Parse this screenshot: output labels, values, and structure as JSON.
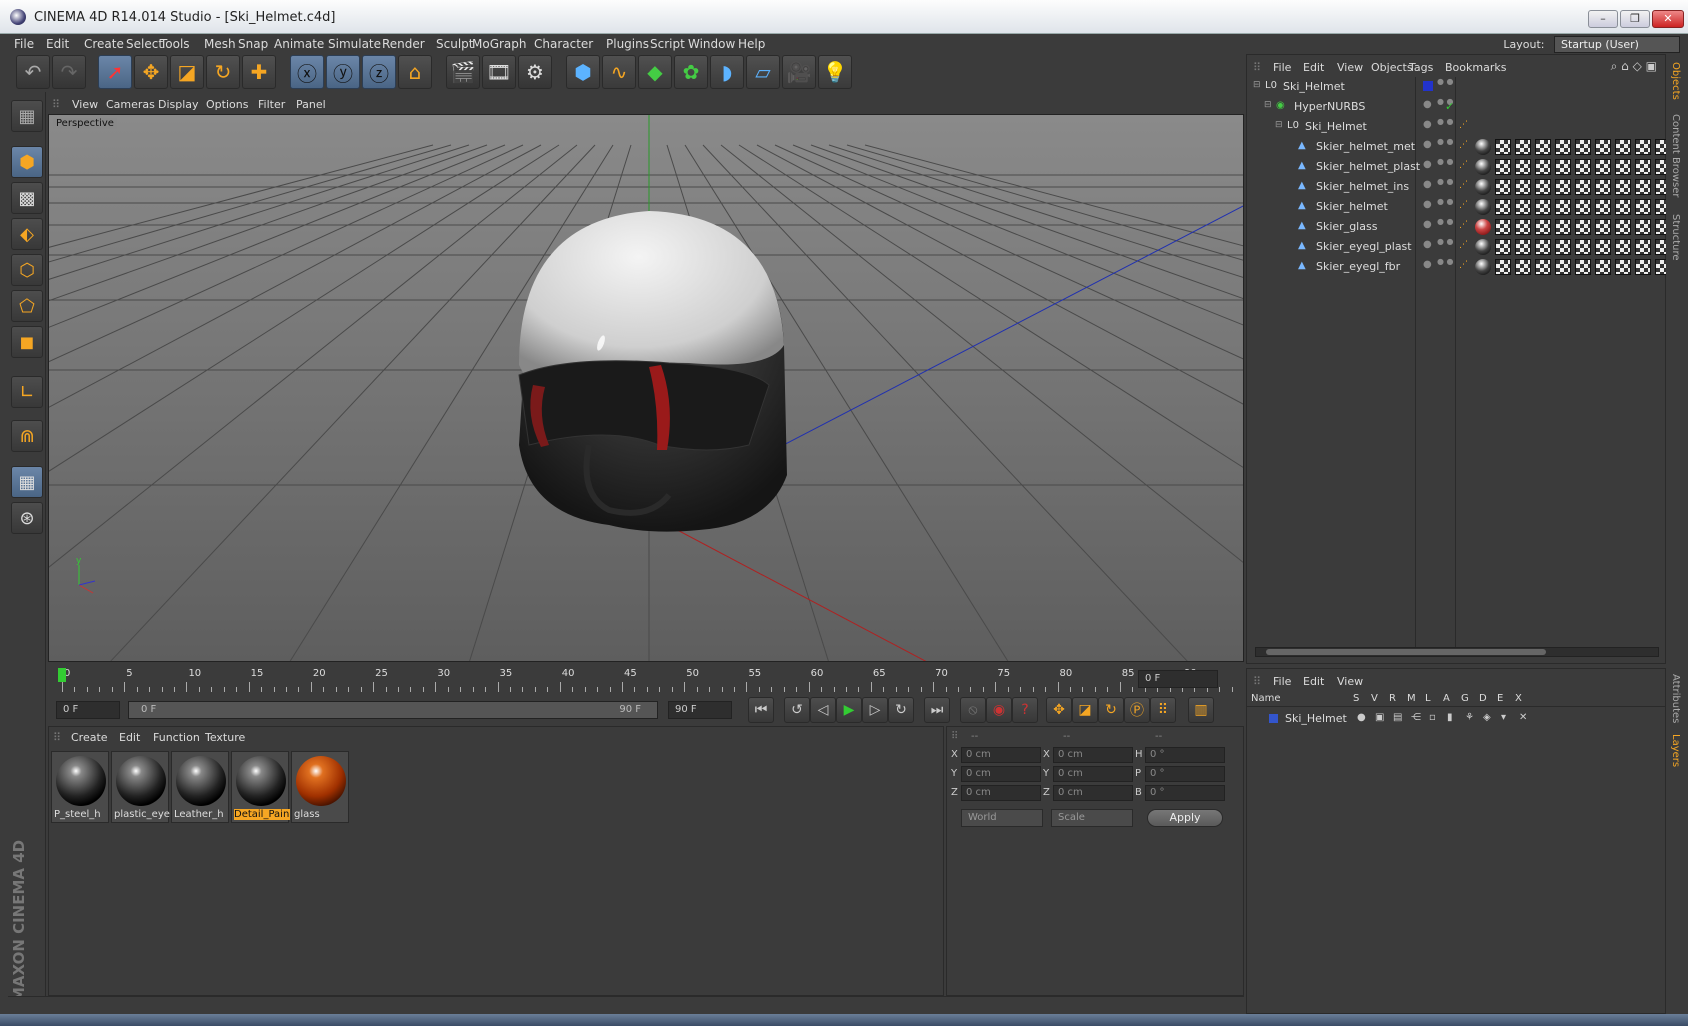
{
  "window": {
    "title": "CINEMA 4D R14.014 Studio - [Ski_Helmet.c4d]"
  },
  "menu": [
    "File",
    "Edit",
    "Create",
    "Select",
    "Tools",
    "Mesh",
    "Snap",
    "Animate",
    "Simulate",
    "Render",
    "Sculpt",
    "MoGraph",
    "Character",
    "Plugins",
    "Script",
    "Window",
    "Help"
  ],
  "layout": {
    "label": "Layout:",
    "value": "Startup (User)"
  },
  "viewport": {
    "menu": [
      "View",
      "Cameras",
      "Display",
      "Options",
      "Filter",
      "Panel"
    ],
    "label": "Perspective"
  },
  "timeline": {
    "ticks": [
      "0",
      "5",
      "10",
      "15",
      "20",
      "25",
      "30",
      "35",
      "40",
      "45",
      "50",
      "55",
      "60",
      "65",
      "70",
      "75",
      "80",
      "85",
      "90"
    ],
    "current_frame": "0 F",
    "start_field": "0 F",
    "range_start": "0 F",
    "range_end": "90 F",
    "end_field": "90 F"
  },
  "material_manager": {
    "menu": [
      "Create",
      "Edit",
      "Function",
      "Texture"
    ],
    "materials": [
      {
        "name": "P_steel_h",
        "kind": "metal"
      },
      {
        "name": "plastic_eye",
        "kind": "metal"
      },
      {
        "name": "Leather_h",
        "kind": "metal"
      },
      {
        "name": "Detail_Pain",
        "kind": "metal",
        "selected": true
      },
      {
        "name": "glass",
        "kind": "glass"
      }
    ]
  },
  "coordinates": {
    "headers": [
      "--",
      "--",
      "--"
    ],
    "rows": [
      {
        "a": "X",
        "av": "0 cm",
        "b": "X",
        "bv": "0 cm",
        "c": "H",
        "cv": "0 °"
      },
      {
        "a": "Y",
        "av": "0 cm",
        "b": "Y",
        "bv": "0 cm",
        "c": "P",
        "cv": "0 °"
      },
      {
        "a": "Z",
        "av": "0 cm",
        "b": "Z",
        "bv": "0 cm",
        "c": "B",
        "cv": "0 °"
      }
    ],
    "space": "World",
    "mode": "Scale",
    "apply": "Apply"
  },
  "object_manager": {
    "menu": [
      "File",
      "Edit",
      "View",
      "Objects",
      "Tags",
      "Bookmarks"
    ],
    "objects": [
      {
        "name": "Ski_Helmet",
        "level": 0,
        "icon": "null-icon",
        "mat": ""
      },
      {
        "name": "HyperNURBS",
        "level": 1,
        "icon": "hypernurbs-icon",
        "mat": ""
      },
      {
        "name": "Ski_Helmet",
        "level": 2,
        "icon": "null-icon",
        "mat": ""
      },
      {
        "name": "Skier_helmet_met",
        "level": 3,
        "icon": "polygon-icon",
        "mat": "metal"
      },
      {
        "name": "Skier_helmet_plast",
        "level": 3,
        "icon": "polygon-icon",
        "mat": "metal"
      },
      {
        "name": "Skier_helmet_ins",
        "level": 3,
        "icon": "polygon-icon",
        "mat": "metal"
      },
      {
        "name": "Skier_helmet",
        "level": 3,
        "icon": "polygon-icon",
        "mat": "metal"
      },
      {
        "name": "Skier_glass",
        "level": 3,
        "icon": "polygon-icon",
        "mat": "glass"
      },
      {
        "name": "Skier_eyegl_plast",
        "level": 3,
        "icon": "polygon-icon",
        "mat": "metal"
      },
      {
        "name": "Skier_eyegl_fbr",
        "level": 3,
        "icon": "polygon-icon",
        "mat": "metal"
      }
    ]
  },
  "layer_manager": {
    "menu": [
      "File",
      "Edit",
      "View"
    ],
    "columns": [
      "Name",
      "S",
      "V",
      "R",
      "M",
      "L",
      "A",
      "G",
      "D",
      "E",
      "X"
    ],
    "layers": [
      {
        "name": "Ski_Helmet",
        "color": "#3355cc"
      }
    ]
  },
  "side_tabs": [
    "Objects",
    "Content Browser",
    "Structure",
    "Attributes",
    "Layers"
  ],
  "brand": "MAXON CINEMA 4D"
}
